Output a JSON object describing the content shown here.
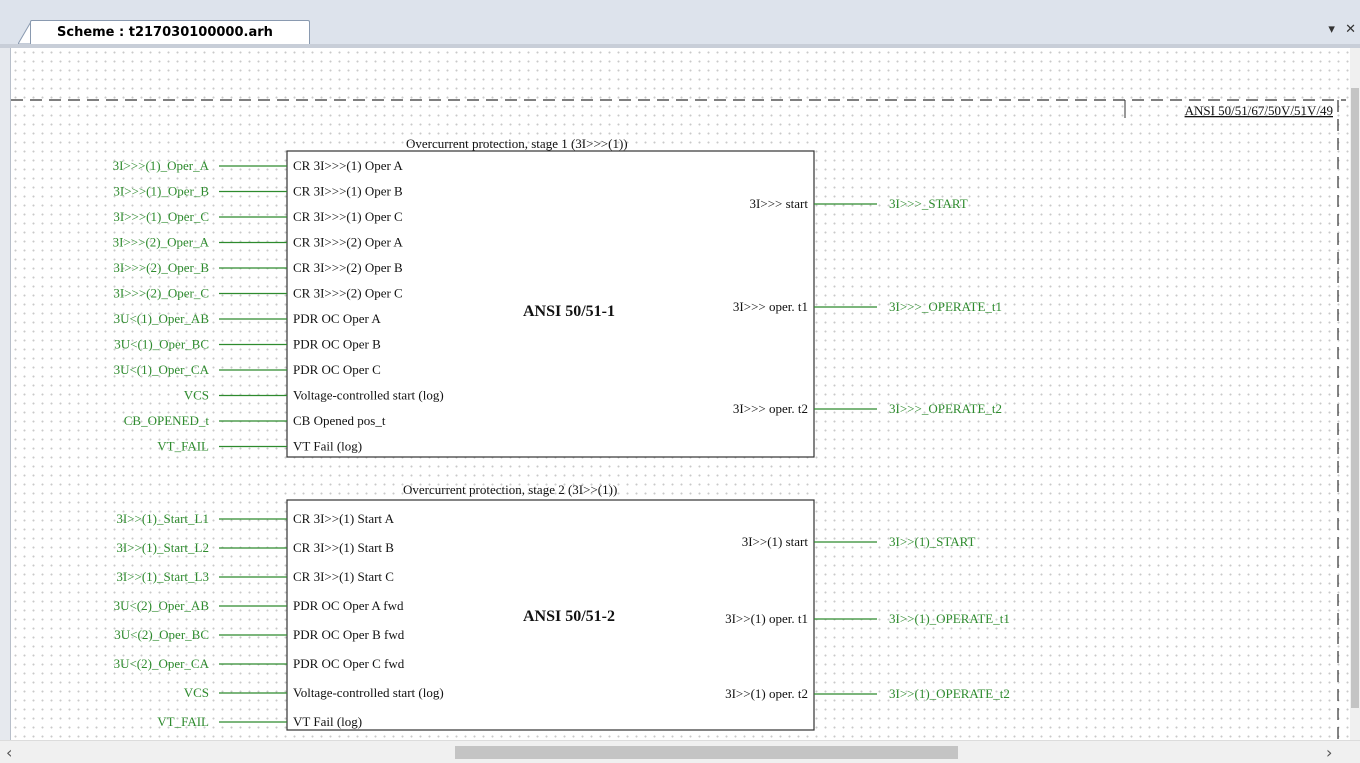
{
  "tab": {
    "title": "Scheme : t217030100000.arh",
    "menu_icon": "▾",
    "close_icon": "✕"
  },
  "frame": {
    "label": "ANSI 50/51/67/50V/51V/49"
  },
  "block1": {
    "caption": "Overcurrent protection, stage 1 (3I>>>(1))",
    "name": "ANSI 50/51-1",
    "signals": [
      "3I>>>(1)_Oper_A",
      "3I>>>(1)_Oper_B",
      "3I>>>(1)_Oper_C",
      "3I>>>(2)_Oper_A",
      "3I>>>(2)_Oper_B",
      "3I>>>(2)_Oper_C",
      "3U<(1)_Oper_AB",
      "3U<(1)_Oper_BC",
      "3U<(1)_Oper_CA",
      "VCS",
      "CB_OPENED_t",
      "VT_FAIL"
    ],
    "ports": [
      "CR 3I>>>(1) Oper A",
      "CR 3I>>>(1) Oper B",
      "CR 3I>>>(1) Oper C",
      "CR 3I>>>(2) Oper A",
      "CR 3I>>>(2) Oper B",
      "CR 3I>>>(2) Oper C",
      "PDR OC Oper A",
      "PDR OC Oper B",
      "PDR OC Oper C",
      "Voltage-controlled start (log)",
      "CB Opened pos_t",
      "VT Fail (log)"
    ],
    "out_ports": [
      "3I>>> start",
      "3I>>> oper. t1",
      "3I>>> oper. t2"
    ],
    "out_signals": [
      "3I>>>_START",
      "3I>>>_OPERATE_t1",
      "3I>>>_OPERATE_t2"
    ]
  },
  "block2": {
    "caption": "Overcurrent protection, stage 2  (3I>>(1))",
    "name": "ANSI 50/51-2",
    "signals": [
      "3I>>(1)_Start_L1",
      "3I>>(1)_Start_L2",
      "3I>>(1)_Start_L3",
      "3U<(2)_Oper_AB",
      "3U<(2)_Oper_BC",
      "3U<(2)_Oper_CA",
      "VCS",
      "VT_FAIL"
    ],
    "ports": [
      "CR 3I>>(1) Start A",
      "CR 3I>>(1) Start B",
      "CR 3I>>(1) Start C",
      "PDR OC Oper A fwd",
      "PDR OC Oper B fwd",
      "PDR OC Oper C fwd",
      "Voltage-controlled start (log)",
      "VT Fail (log)"
    ],
    "out_ports": [
      "3I>>(1) start",
      "3I>>(1) oper. t1",
      "3I>>(1) oper. t2"
    ],
    "out_signals": [
      "3I>>(1)_START",
      "3I>>(1)_OPERATE_t1",
      "3I>>(1)_OPERATE_t2"
    ]
  },
  "colors": {
    "signal": "#2e8b2e",
    "wire": "#2e8b2e",
    "block_border": "#333333",
    "text": "#111111"
  }
}
